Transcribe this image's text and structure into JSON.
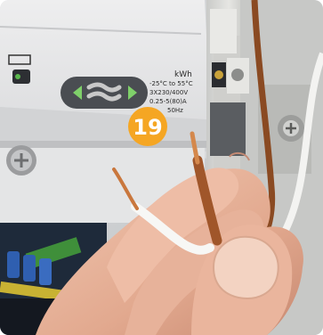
{
  "step": {
    "number": "19",
    "color": "#f5a623"
  },
  "meter_label": {
    "unit": "kWh",
    "temp_range": "-25°C to 55°C",
    "voltage": "3X230/400V",
    "current": "0.25-5(80)A",
    "frequency": "50Hz"
  },
  "colors": {
    "meter_body": "#e9eaeb",
    "rail": "#d9d9d6",
    "brown_wire": "#a0562a",
    "white_wire": "#f4f4f2",
    "copper": "#c9773d",
    "skin": "#e8b8a0"
  }
}
